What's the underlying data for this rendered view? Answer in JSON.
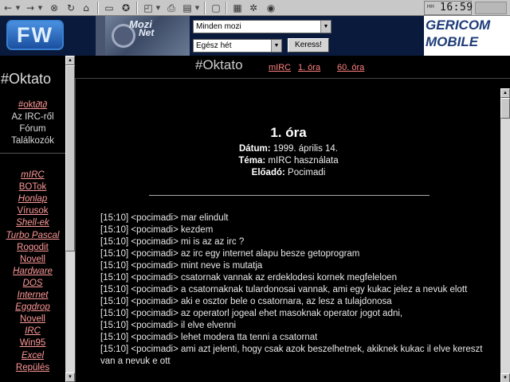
{
  "toolbar": {
    "icons": [
      "back-arrow-icon",
      "forward-arrow-icon",
      "stop-icon",
      "refresh-icon",
      "home-icon",
      "search-icon",
      "favorites-icon",
      "history-icon",
      "print-icon",
      "edit-icon",
      "media-icon",
      "channels-icon",
      "fullscreen-icon"
    ],
    "clock": "16:59",
    "clock_signal": "HH"
  },
  "banner": {
    "logo_text": "FW",
    "movie_ad_logo_1": "Mozi",
    "movie_ad_logo_2": "Net",
    "cinema_select": "Minden mozi",
    "period_select": "Egész hét",
    "search_button": "Keress!",
    "sponsor_line1": "GERICOM",
    "sponsor_line2": "MOBILE"
  },
  "sidebar": {
    "title": "#Oktato",
    "top_items": [
      {
        "label": "#okt∂t∂",
        "link": true
      },
      {
        "label": "Az IRC-ről",
        "link": false
      },
      {
        "label": "Fórum",
        "link": false
      },
      {
        "label": "Találkozók",
        "link": false
      }
    ],
    "items": [
      {
        "label": "mIRC",
        "italic": true
      },
      {
        "label": "BOTok",
        "italic": false
      },
      {
        "label": "Honlap",
        "italic": true
      },
      {
        "label": "Vírusok",
        "italic": false
      },
      {
        "label": "Shell-ek",
        "italic": true
      },
      {
        "label": "Turbo Pascal",
        "italic": true
      },
      {
        "label": "Rogodit",
        "italic": false
      },
      {
        "label": "Novell",
        "italic": false
      },
      {
        "label": "Hardware",
        "italic": true
      },
      {
        "label": "DOS",
        "italic": true
      },
      {
        "label": "Internet",
        "italic": true
      },
      {
        "label": "Eggdrop",
        "italic": true
      },
      {
        "label": "Novell",
        "italic": false
      },
      {
        "label": "IRC",
        "italic": true
      },
      {
        "label": "Win95",
        "italic": false
      },
      {
        "label": "Excel",
        "italic": true
      },
      {
        "label": "Repülés",
        "italic": false
      }
    ]
  },
  "header": {
    "title": "#Oktato",
    "links": [
      "mIRC",
      "1. óra",
      "60. óra"
    ]
  },
  "lesson": {
    "title": "1. óra",
    "date_label": "Dátum:",
    "date_value": "1999. április 14.",
    "topic_label": "Téma:",
    "topic_value": "mIRC használata",
    "speaker_label": "Előadó:",
    "speaker_value": "Pocimadi",
    "log": [
      "[15:10] <pocimadi> mar elindult",
      "[15:10] <pocimadi> kezdem",
      "[15:10] <pocimadi> mi is az az irc ?",
      "[15:10] <pocimadi> az irc egy internet alapu besze getoprogram",
      "[15:10] <pocimadi> mint neve is mutatja",
      "[15:10] <pocimadi> csatornak vannak az erdeklodesi kornek megfeleloen",
      "[15:10] <pocimadi> a csatornaknak tulardonosai vannak, ami egy kukac jelez a nevuk elott",
      "[15:10] <pocimadi> aki e osztor bele o csatornara, az lesz a tulajdonosa",
      "[15:10] <pocimadi> az operatorl jogeal ehet masoknak operator jogot adni,",
      "[15:10] <pocimadi> il elve elvenni",
      "[15:10] <pocimadi> lehet modera tta tenni a csatornat",
      "[15:10] <pocimadi> ami azt jelenti, hogy csak azok beszelhetnek, akiknek kukac il elve kereszt van a nevuk e ott"
    ]
  }
}
